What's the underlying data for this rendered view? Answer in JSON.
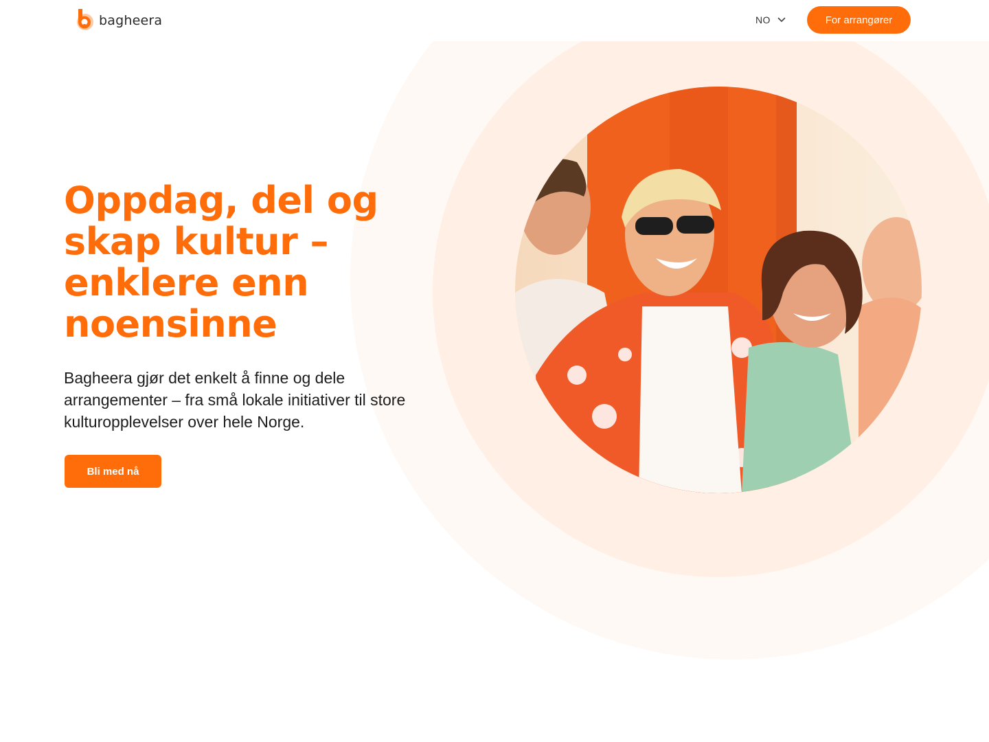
{
  "brand": {
    "name": "bagheera",
    "accent_color": "#ff6d0a",
    "logo_icon": "bagheera-logo-icon"
  },
  "header": {
    "language": {
      "selected": "NO",
      "icon": "chevron-down-icon"
    },
    "organizers_button": "For arrangører"
  },
  "hero": {
    "title": "Oppdag, del og skap kultur – enklere enn noensinne",
    "lead": "Bagheera gjør det enkelt å finne og dele arrangementer – fra små lokale initiativer til store kulturopplevelser over hele Norge.",
    "cta": "Bli med nå"
  }
}
